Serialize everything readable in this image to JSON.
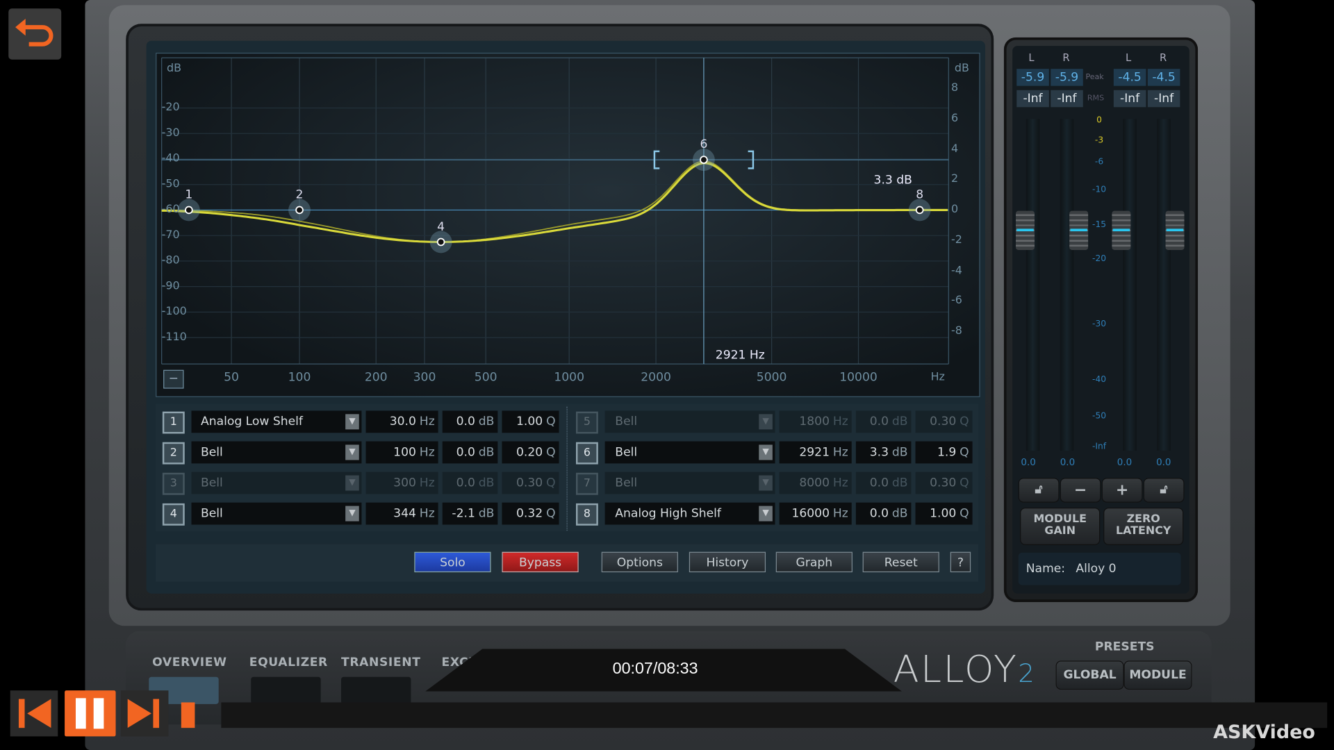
{
  "player": {
    "time": "00:07/08:33",
    "watermark": "ASKVideo",
    "accent": "#f26522"
  },
  "graph": {
    "left_axis_unit": "dB",
    "right_axis_unit": "dB",
    "left_ticks": [
      "-20",
      "-30",
      "-40",
      "-50",
      "-60",
      "-70",
      "-80",
      "-90",
      "-100",
      "-110"
    ],
    "right_ticks": [
      "8",
      "6",
      "4",
      "2",
      "0",
      "-2",
      "-4",
      "-6",
      "-8"
    ],
    "freq_ticks": [
      "50",
      "100",
      "200",
      "300",
      "500",
      "1000",
      "2000",
      "5000",
      "10000"
    ],
    "freq_unit": "Hz",
    "cursor_gain_readout": "3.3 dB",
    "cursor_freq_readout": "2921 Hz",
    "selected_band": "6",
    "curve_color": "#d9d93a",
    "nodes": [
      {
        "label": "1",
        "freq": 30,
        "gain": 0.0
      },
      {
        "label": "2",
        "freq": 100,
        "gain": 0.0
      },
      {
        "label": "4",
        "freq": 344,
        "gain": -2.1
      },
      {
        "label": "6",
        "freq": 2921,
        "gain": 3.3
      },
      {
        "label": "8",
        "freq": 16000,
        "gain": 0.0
      }
    ]
  },
  "bands": [
    {
      "num": "1",
      "type": "Analog Low Shelf",
      "freq": "30.0",
      "freq_unit": "Hz",
      "gain": "0.0",
      "gain_unit": "dB",
      "q": "1.00",
      "q_unit": "Q",
      "enabled": true
    },
    {
      "num": "2",
      "type": "Bell",
      "freq": "100",
      "freq_unit": "Hz",
      "gain": "0.0",
      "gain_unit": "dB",
      "q": "0.20",
      "q_unit": "Q",
      "enabled": true
    },
    {
      "num": "3",
      "type": "Bell",
      "freq": "300",
      "freq_unit": "Hz",
      "gain": "0.0",
      "gain_unit": "dB",
      "q": "0.30",
      "q_unit": "Q",
      "enabled": false
    },
    {
      "num": "4",
      "type": "Bell",
      "freq": "344",
      "freq_unit": "Hz",
      "gain": "-2.1",
      "gain_unit": "dB",
      "q": "0.32",
      "q_unit": "Q",
      "enabled": true
    },
    {
      "num": "5",
      "type": "Bell",
      "freq": "1800",
      "freq_unit": "Hz",
      "gain": "0.0",
      "gain_unit": "dB",
      "q": "0.30",
      "q_unit": "Q",
      "enabled": false
    },
    {
      "num": "6",
      "type": "Bell",
      "freq": "2921",
      "freq_unit": "Hz",
      "gain": "3.3",
      "gain_unit": "dB",
      "q": "1.9",
      "q_unit": "Q",
      "enabled": true
    },
    {
      "num": "7",
      "type": "Bell",
      "freq": "8000",
      "freq_unit": "Hz",
      "gain": "0.0",
      "gain_unit": "dB",
      "q": "0.30",
      "q_unit": "Q",
      "enabled": false
    },
    {
      "num": "8",
      "type": "Analog High Shelf",
      "freq": "16000",
      "freq_unit": "Hz",
      "gain": "0.0",
      "gain_unit": "dB",
      "q": "1.00",
      "q_unit": "Q",
      "enabled": true
    }
  ],
  "toolbar": {
    "solo": "Solo",
    "bypass": "Bypass",
    "options": "Options",
    "history": "History",
    "graph": "Graph",
    "reset": "Reset",
    "help": "?"
  },
  "meters": {
    "channels": [
      "L",
      "R",
      "L",
      "R"
    ],
    "peak_label": "Peak",
    "rms_label": "RMS",
    "peak": [
      "-5.9",
      "-5.9",
      "-4.5",
      "-4.5"
    ],
    "rms": [
      "-Inf",
      "-Inf",
      "-Inf",
      "-Inf"
    ],
    "scale": [
      "0",
      "-3",
      "-6",
      "-10",
      "-15",
      "-20",
      "-30",
      "-40",
      "-50",
      "-Inf"
    ],
    "fader_values": [
      "0.0",
      "0.0",
      "0.0",
      "0.0"
    ],
    "minus": "−",
    "plus": "+",
    "module_gain": "MODULE GAIN",
    "zero_latency": "ZERO LATENCY",
    "name_label": "Name:",
    "name_value": "Alloy 0"
  },
  "bottom": {
    "tabs": [
      "OVERVIEW",
      "EQUALIZER",
      "TRANSIENT",
      "EXCI"
    ],
    "logo": "ALLOY",
    "logo_suffix": "2",
    "presets_label": "PRESETS",
    "global": "GLOBAL",
    "module": "MODULE"
  }
}
